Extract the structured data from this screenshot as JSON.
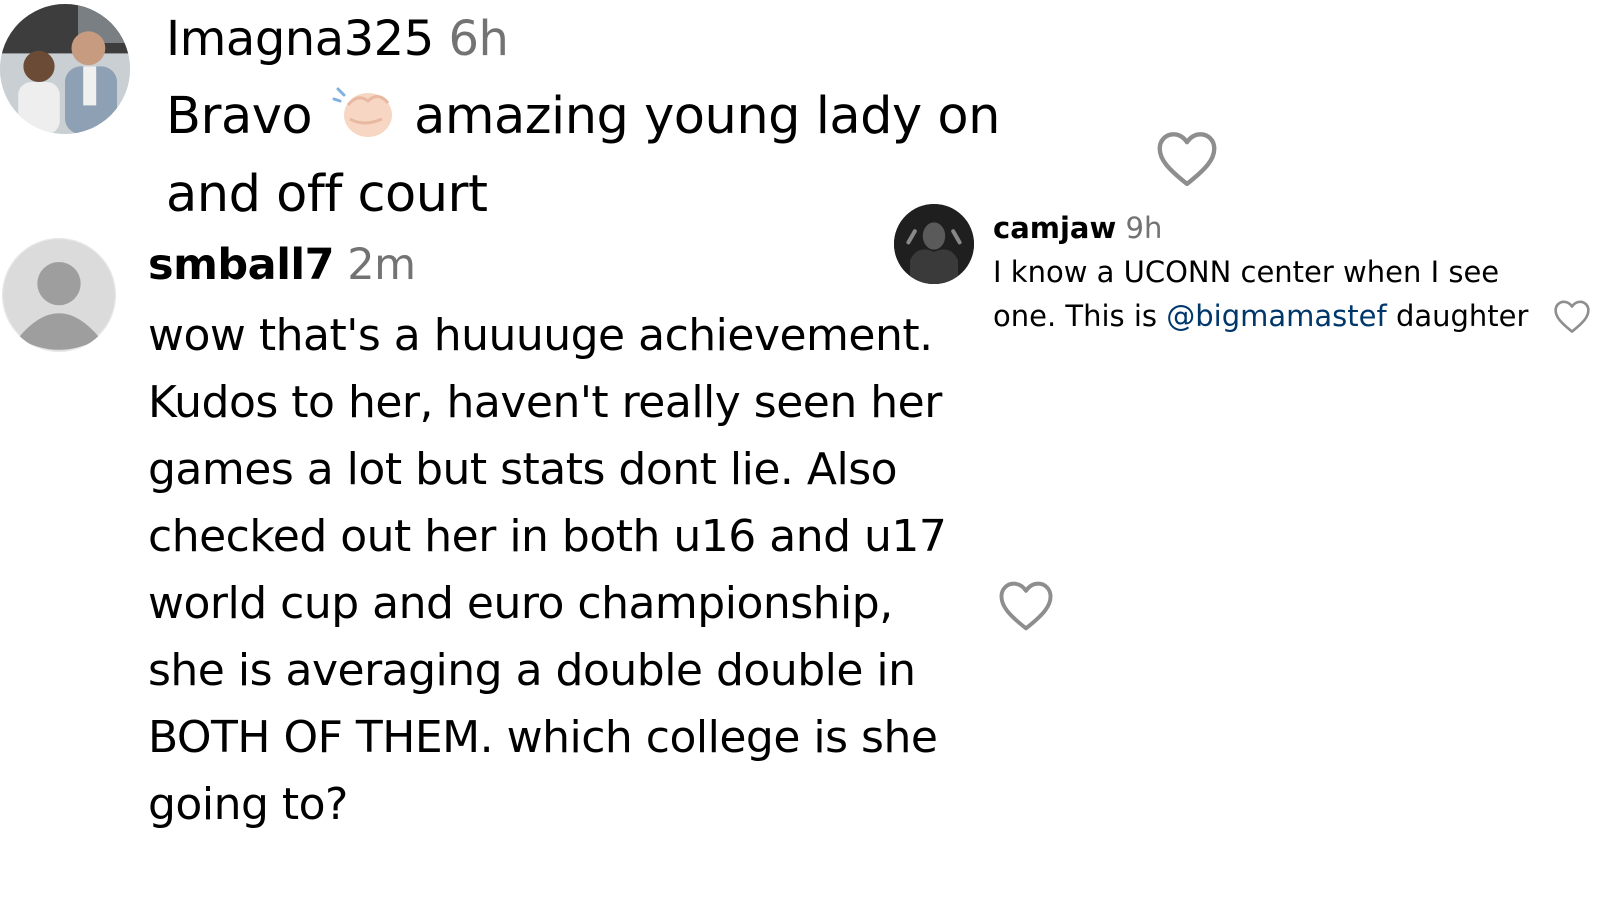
{
  "comments": [
    {
      "username": "Imagna325",
      "time": "6h",
      "text_before_emoji": "Bravo",
      "emoji": "clapping-hands-icon",
      "text_after_emoji": "amazing young lady on and off court"
    },
    {
      "username": "smball7",
      "time": "2m",
      "text": "wow that's a huuuuge achievement. Kudos to her, haven't really seen her games a lot but stats dont lie. Also checked out her in both u16 and u17 world cup and euro championship, she is averaging a double double in BOTH OF THEM. which college is she going to?"
    },
    {
      "username": "camjaw",
      "time": "9h",
      "text_before_mention": "I know a UCONN center when I see one. This is",
      "mention": "@bigmamastef",
      "text_after_mention": "daughter"
    }
  ],
  "colors": {
    "mention": "#00376b",
    "timestamp": "#737373",
    "heart_outline": "#8e8e8e"
  }
}
